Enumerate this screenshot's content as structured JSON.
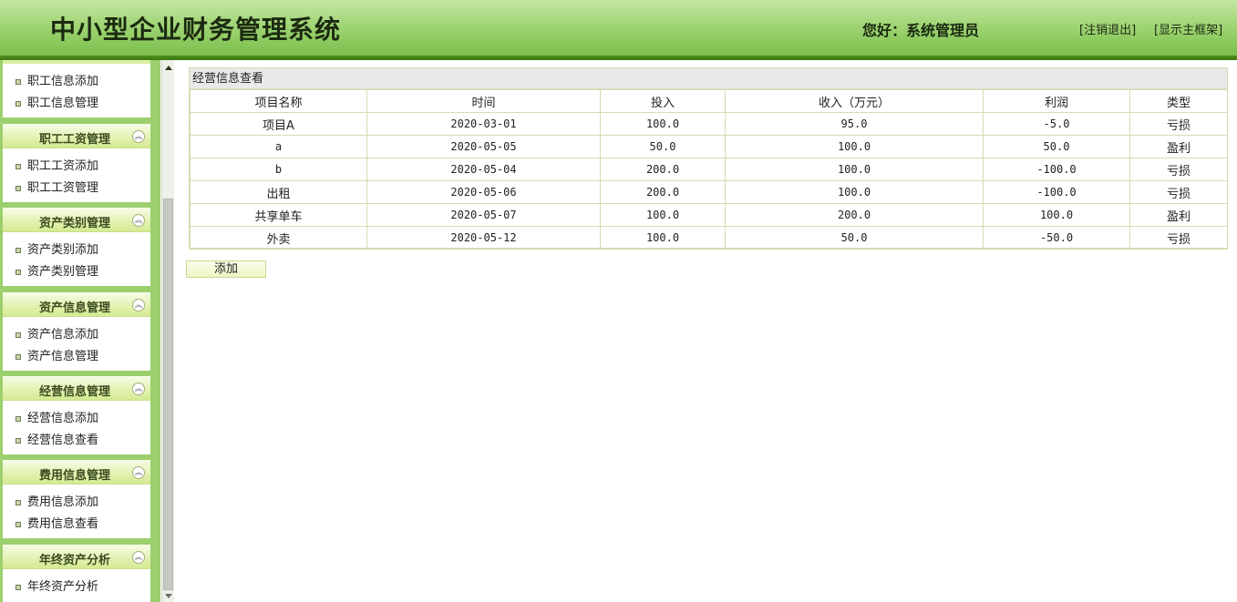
{
  "header": {
    "app_title": "中小型企业财务管理系统",
    "greeting": "您好：系统管理员",
    "logout_label": "[注销退出]",
    "show_frame_label": "[显示主框架]"
  },
  "sidebar": {
    "groups": [
      {
        "title": "",
        "items": [
          "职工信息添加",
          "职工信息管理"
        ]
      },
      {
        "title": "职工工资管理",
        "items": [
          "职工工资添加",
          "职工工资管理"
        ]
      },
      {
        "title": "资产类别管理",
        "items": [
          "资产类别添加",
          "资产类别管理"
        ]
      },
      {
        "title": "资产信息管理",
        "items": [
          "资产信息添加",
          "资产信息管理"
        ]
      },
      {
        "title": "经营信息管理",
        "items": [
          "经营信息添加",
          "经营信息查看"
        ]
      },
      {
        "title": "费用信息管理",
        "items": [
          "费用信息添加",
          "费用信息查看"
        ]
      },
      {
        "title": "年终资产分析",
        "items": [
          "年终资产分析"
        ]
      }
    ]
  },
  "main": {
    "panel_title": "经营信息查看",
    "columns": [
      "项目名称",
      "时间",
      "投入",
      "收入（万元）",
      "利润",
      "类型"
    ],
    "rows": [
      [
        "项目A",
        "2020-03-01",
        "100.0",
        "95.0",
        "-5.0",
        "亏损"
      ],
      [
        "a",
        "2020-05-05",
        "50.0",
        "100.0",
        "50.0",
        "盈利"
      ],
      [
        "b",
        "2020-05-04",
        "200.0",
        "100.0",
        "-100.0",
        "亏损"
      ],
      [
        "出租",
        "2020-05-06",
        "200.0",
        "100.0",
        "-100.0",
        "亏损"
      ],
      [
        "共享单车",
        "2020-05-07",
        "100.0",
        "200.0",
        "100.0",
        "盈利"
      ],
      [
        "外卖",
        "2020-05-12",
        "100.0",
        "50.0",
        "-50.0",
        "亏损"
      ]
    ],
    "add_label": "添加"
  }
}
